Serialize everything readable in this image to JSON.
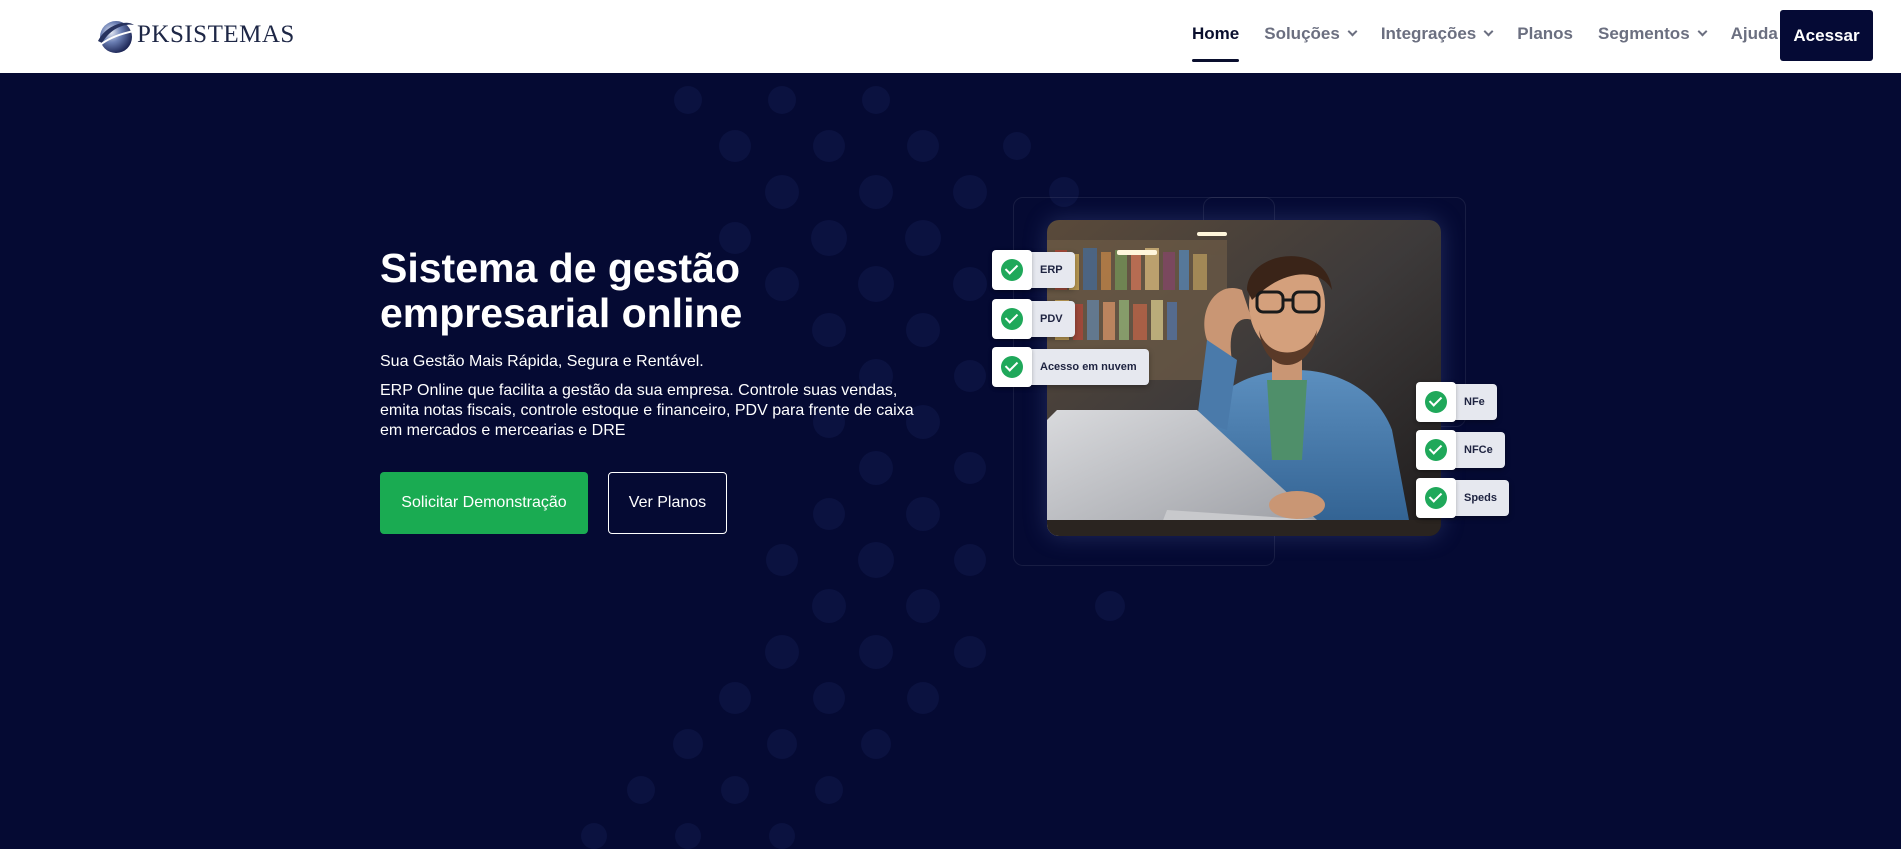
{
  "header": {
    "logo_text": "PKSISTEMAS",
    "nav": [
      {
        "label": "Home",
        "active": true,
        "dropdown": false
      },
      {
        "label": "Soluções",
        "active": false,
        "dropdown": true
      },
      {
        "label": "Integrações",
        "active": false,
        "dropdown": true
      },
      {
        "label": "Planos",
        "active": false,
        "dropdown": false
      },
      {
        "label": "Segmentos",
        "active": false,
        "dropdown": true
      },
      {
        "label": "Ajuda",
        "active": false,
        "dropdown": false
      }
    ],
    "cta_label": "Acessar"
  },
  "hero": {
    "title": "Sistema de gestão empresarial online",
    "subtitle": "Sua Gestão Mais Rápida, Segura e Rentável.",
    "description": "ERP Online que facilita a gestão da sua empresa. Controle suas vendas, emita notas fiscais, controle estoque e financeiro, PDV para frente de caixa em mercados e mercearias e DRE",
    "primary_button": "Solicitar Demonstração",
    "secondary_button": "Ver Planos",
    "features_left": [
      "ERP",
      "PDV",
      "Acesso em nuvem"
    ],
    "features_right": [
      "NFe",
      "NFCe",
      "Speds"
    ]
  },
  "colors": {
    "hero_bg": "#050a33",
    "primary_green": "#1aab52",
    "dark_navy": "#050a35",
    "check_green": "#1fa85a"
  },
  "icons": [
    "logo-swoosh-icon",
    "chevron-down-icon",
    "check-circle-icon"
  ]
}
